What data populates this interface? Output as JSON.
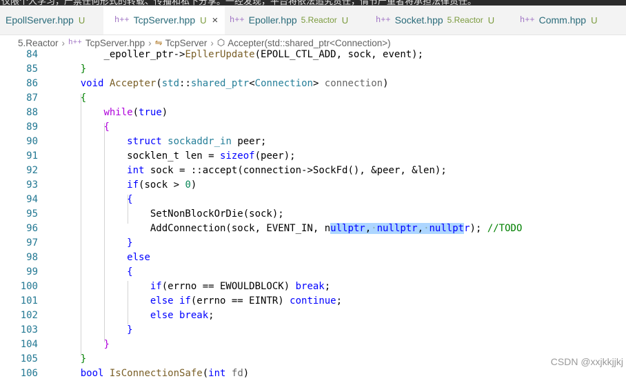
{
  "top_banner": "仅限个人学习，严禁任何形式的转载、传播和私下分享。一经发现，平台将依法追究责任，情节严重者将承担法律责任。",
  "tabs": [
    {
      "icon": "",
      "name": "EpollServer.hpp",
      "sub": "",
      "status": "U",
      "active": false
    },
    {
      "icon": "h++",
      "name": "TcpServer.hpp",
      "sub": "",
      "status": "U",
      "active": true,
      "close": "×"
    },
    {
      "icon": "h++",
      "name": "Epoller.hpp",
      "sub": "5.Reactor",
      "status": "U",
      "active": false
    },
    {
      "icon": "h++",
      "name": "Socket.hpp",
      "sub": "5.Reactor",
      "status": "U",
      "active": false
    },
    {
      "icon": "h++",
      "name": "Comm.hpp",
      "sub": "",
      "status": "U",
      "active": false
    }
  ],
  "breadcrumb": {
    "folder": "5.Reactor",
    "file_icon": "h++",
    "file": "TcpServer.hpp",
    "class": "TcpServer",
    "method": "Accepter(std::shared_ptr<Connection>)"
  },
  "code": {
    "line_numbers": [
      "84",
      "85",
      "86",
      "87",
      "88",
      "89",
      "90",
      "91",
      "92",
      "93",
      "94",
      "95",
      "96",
      "97",
      "98",
      "99",
      "100",
      "101",
      "102",
      "103",
      "104",
      "105",
      "106"
    ]
  },
  "watermark": "CSDN @xxjkkjjkj"
}
